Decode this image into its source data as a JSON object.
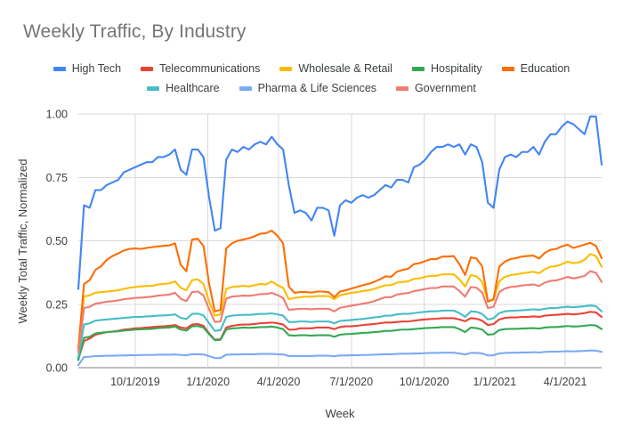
{
  "chart_data": {
    "type": "line",
    "title": "Weekly Traffic, By Industry",
    "xlabel": "Week",
    "ylabel": "Weekly Total Traffic, Normalized",
    "ylim": [
      0.0,
      1.0
    ],
    "y_ticks": [
      "0.00",
      "0.25",
      "0.50",
      "0.75",
      "1.00"
    ],
    "y_tick_values": [
      0.0,
      0.25,
      0.5,
      0.75,
      1.0
    ],
    "x_ticks": [
      "10/1/2019",
      "1/1/2020",
      "4/1/2020",
      "7/1/2020",
      "10/1/2020",
      "1/1/2021",
      "4/1/2021"
    ],
    "x_tick_positions": [
      0.1087,
      0.2478,
      0.3826,
      0.5217,
      0.6609,
      0.7957,
      0.9304
    ],
    "grid": true,
    "legend_position": "top",
    "n_points": 93,
    "series": [
      {
        "name": "High Tech",
        "color": "#4285f4",
        "values": [
          0.31,
          0.64,
          0.63,
          0.7,
          0.7,
          0.72,
          0.73,
          0.74,
          0.77,
          0.78,
          0.79,
          0.8,
          0.81,
          0.81,
          0.83,
          0.83,
          0.84,
          0.86,
          0.78,
          0.76,
          0.86,
          0.86,
          0.83,
          0.67,
          0.54,
          0.55,
          0.82,
          0.86,
          0.85,
          0.87,
          0.86,
          0.88,
          0.89,
          0.88,
          0.91,
          0.88,
          0.86,
          0.72,
          0.61,
          0.62,
          0.61,
          0.58,
          0.63,
          0.63,
          0.62,
          0.52,
          0.64,
          0.66,
          0.65,
          0.67,
          0.68,
          0.67,
          0.68,
          0.7,
          0.72,
          0.71,
          0.74,
          0.74,
          0.73,
          0.79,
          0.8,
          0.82,
          0.85,
          0.87,
          0.87,
          0.88,
          0.87,
          0.88,
          0.84,
          0.88,
          0.87,
          0.81,
          0.65,
          0.63,
          0.78,
          0.83,
          0.84,
          0.83,
          0.85,
          0.85,
          0.87,
          0.84,
          0.89,
          0.92,
          0.92,
          0.95,
          0.97,
          0.96,
          0.94,
          0.92,
          0.99,
          0.99,
          0.8
        ]
      },
      {
        "name": "Telecommunications",
        "color": "#ea4335",
        "values": [
          0.035,
          0.105,
          0.115,
          0.13,
          0.135,
          0.14,
          0.142,
          0.145,
          0.15,
          0.152,
          0.155,
          0.156,
          0.158,
          0.16,
          0.162,
          0.163,
          0.165,
          0.168,
          0.158,
          0.155,
          0.17,
          0.172,
          0.165,
          0.135,
          0.11,
          0.112,
          0.158,
          0.165,
          0.168,
          0.17,
          0.17,
          0.172,
          0.175,
          0.176,
          0.178,
          0.175,
          0.17,
          0.15,
          0.15,
          0.155,
          0.155,
          0.155,
          0.158,
          0.158,
          0.158,
          0.152,
          0.16,
          0.163,
          0.163,
          0.165,
          0.168,
          0.17,
          0.172,
          0.175,
          0.178,
          0.178,
          0.18,
          0.182,
          0.182,
          0.185,
          0.188,
          0.19,
          0.192,
          0.193,
          0.195,
          0.195,
          0.195,
          0.19,
          0.183,
          0.195,
          0.193,
          0.185,
          0.168,
          0.172,
          0.19,
          0.196,
          0.198,
          0.198,
          0.2,
          0.2,
          0.202,
          0.2,
          0.205,
          0.207,
          0.208,
          0.21,
          0.212,
          0.21,
          0.212,
          0.215,
          0.22,
          0.218,
          0.2
        ]
      },
      {
        "name": "Wholesale & Retail",
        "color": "#fbbc04",
        "values": [
          0.075,
          0.28,
          0.285,
          0.295,
          0.298,
          0.3,
          0.302,
          0.305,
          0.31,
          0.315,
          0.318,
          0.32,
          0.322,
          0.322,
          0.328,
          0.33,
          0.332,
          0.34,
          0.315,
          0.305,
          0.345,
          0.348,
          0.33,
          0.26,
          0.205,
          0.21,
          0.31,
          0.318,
          0.32,
          0.322,
          0.32,
          0.325,
          0.33,
          0.328,
          0.34,
          0.325,
          0.315,
          0.27,
          0.275,
          0.278,
          0.28,
          0.28,
          0.282,
          0.282,
          0.282,
          0.27,
          0.285,
          0.29,
          0.295,
          0.298,
          0.302,
          0.305,
          0.31,
          0.318,
          0.325,
          0.325,
          0.335,
          0.338,
          0.34,
          0.35,
          0.352,
          0.358,
          0.362,
          0.362,
          0.368,
          0.368,
          0.368,
          0.348,
          0.32,
          0.365,
          0.36,
          0.338,
          0.262,
          0.268,
          0.34,
          0.358,
          0.365,
          0.368,
          0.372,
          0.375,
          0.378,
          0.372,
          0.388,
          0.398,
          0.4,
          0.408,
          0.418,
          0.412,
          0.415,
          0.425,
          0.448,
          0.44,
          0.398
        ]
      },
      {
        "name": "Hospitality",
        "color": "#34a853",
        "values": [
          0.03,
          0.118,
          0.122,
          0.135,
          0.138,
          0.14,
          0.142,
          0.143,
          0.146,
          0.148,
          0.15,
          0.151,
          0.152,
          0.153,
          0.156,
          0.157,
          0.158,
          0.162,
          0.15,
          0.146,
          0.163,
          0.164,
          0.158,
          0.132,
          0.108,
          0.11,
          0.15,
          0.155,
          0.156,
          0.158,
          0.157,
          0.158,
          0.16,
          0.16,
          0.162,
          0.158,
          0.152,
          0.128,
          0.126,
          0.128,
          0.128,
          0.126,
          0.128,
          0.128,
          0.128,
          0.122,
          0.13,
          0.132,
          0.133,
          0.135,
          0.137,
          0.138,
          0.14,
          0.142,
          0.145,
          0.145,
          0.148,
          0.15,
          0.15,
          0.152,
          0.154,
          0.156,
          0.157,
          0.158,
          0.16,
          0.16,
          0.16,
          0.152,
          0.14,
          0.158,
          0.156,
          0.15,
          0.13,
          0.132,
          0.148,
          0.152,
          0.153,
          0.153,
          0.154,
          0.155,
          0.156,
          0.154,
          0.158,
          0.16,
          0.16,
          0.162,
          0.164,
          0.162,
          0.163,
          0.165,
          0.168,
          0.166,
          0.152
        ]
      },
      {
        "name": "Education",
        "color": "#ff6d01",
        "values": [
          0.075,
          0.33,
          0.345,
          0.385,
          0.4,
          0.425,
          0.44,
          0.45,
          0.462,
          0.468,
          0.47,
          0.468,
          0.472,
          0.475,
          0.478,
          0.48,
          0.482,
          0.49,
          0.405,
          0.38,
          0.505,
          0.508,
          0.48,
          0.33,
          0.222,
          0.228,
          0.47,
          0.49,
          0.5,
          0.505,
          0.51,
          0.518,
          0.528,
          0.53,
          0.54,
          0.52,
          0.49,
          0.32,
          0.295,
          0.298,
          0.298,
          0.296,
          0.3,
          0.3,
          0.298,
          0.278,
          0.3,
          0.305,
          0.312,
          0.318,
          0.325,
          0.33,
          0.338,
          0.348,
          0.36,
          0.358,
          0.378,
          0.385,
          0.39,
          0.408,
          0.412,
          0.42,
          0.428,
          0.428,
          0.438,
          0.438,
          0.44,
          0.408,
          0.365,
          0.435,
          0.43,
          0.4,
          0.26,
          0.27,
          0.398,
          0.418,
          0.428,
          0.432,
          0.438,
          0.44,
          0.442,
          0.43,
          0.452,
          0.465,
          0.468,
          0.478,
          0.485,
          0.472,
          0.478,
          0.485,
          0.492,
          0.48,
          0.432
        ]
      },
      {
        "name": "Healthcare",
        "color": "#46bdc6",
        "values": [
          0.04,
          0.17,
          0.175,
          0.185,
          0.188,
          0.19,
          0.192,
          0.194,
          0.196,
          0.198,
          0.2,
          0.2,
          0.202,
          0.203,
          0.205,
          0.206,
          0.207,
          0.21,
          0.196,
          0.192,
          0.212,
          0.213,
          0.206,
          0.175,
          0.145,
          0.148,
          0.2,
          0.205,
          0.207,
          0.208,
          0.208,
          0.21,
          0.212,
          0.212,
          0.214,
          0.21,
          0.205,
          0.18,
          0.18,
          0.182,
          0.182,
          0.18,
          0.182,
          0.182,
          0.182,
          0.175,
          0.184,
          0.186,
          0.188,
          0.19,
          0.192,
          0.195,
          0.198,
          0.2,
          0.205,
          0.205,
          0.21,
          0.212,
          0.212,
          0.215,
          0.218,
          0.22,
          0.222,
          0.222,
          0.225,
          0.225,
          0.225,
          0.215,
          0.2,
          0.222,
          0.22,
          0.212,
          0.19,
          0.195,
          0.215,
          0.222,
          0.224,
          0.225,
          0.226,
          0.228,
          0.23,
          0.228,
          0.232,
          0.235,
          0.235,
          0.238,
          0.24,
          0.238,
          0.24,
          0.242,
          0.245,
          0.242,
          0.222
        ]
      },
      {
        "name": "Pharma & Life Sciences",
        "color": "#7baaf7",
        "values": [
          0.01,
          0.042,
          0.043,
          0.046,
          0.046,
          0.047,
          0.047,
          0.048,
          0.048,
          0.049,
          0.049,
          0.05,
          0.05,
          0.05,
          0.051,
          0.051,
          0.051,
          0.052,
          0.05,
          0.049,
          0.053,
          0.053,
          0.052,
          0.045,
          0.038,
          0.038,
          0.051,
          0.052,
          0.052,
          0.053,
          0.053,
          0.053,
          0.054,
          0.054,
          0.054,
          0.053,
          0.052,
          0.046,
          0.046,
          0.046,
          0.046,
          0.046,
          0.047,
          0.047,
          0.047,
          0.045,
          0.048,
          0.048,
          0.049,
          0.049,
          0.05,
          0.05,
          0.051,
          0.052,
          0.053,
          0.053,
          0.054,
          0.055,
          0.055,
          0.056,
          0.056,
          0.057,
          0.058,
          0.058,
          0.059,
          0.059,
          0.059,
          0.056,
          0.052,
          0.058,
          0.058,
          0.056,
          0.048,
          0.049,
          0.056,
          0.058,
          0.059,
          0.059,
          0.06,
          0.06,
          0.061,
          0.06,
          0.062,
          0.063,
          0.063,
          0.064,
          0.065,
          0.064,
          0.065,
          0.066,
          0.068,
          0.067,
          0.062
        ]
      },
      {
        "name": "Government",
        "color": "#f07b72",
        "values": [
          0.06,
          0.235,
          0.24,
          0.252,
          0.256,
          0.26,
          0.262,
          0.265,
          0.27,
          0.272,
          0.275,
          0.276,
          0.278,
          0.28,
          0.284,
          0.286,
          0.288,
          0.295,
          0.272,
          0.262,
          0.298,
          0.3,
          0.285,
          0.23,
          0.18,
          0.182,
          0.272,
          0.28,
          0.282,
          0.284,
          0.283,
          0.286,
          0.29,
          0.29,
          0.295,
          0.286,
          0.275,
          0.228,
          0.23,
          0.232,
          0.232,
          0.23,
          0.232,
          0.232,
          0.232,
          0.222,
          0.236,
          0.24,
          0.244,
          0.248,
          0.252,
          0.256,
          0.262,
          0.27,
          0.278,
          0.278,
          0.288,
          0.292,
          0.294,
          0.302,
          0.305,
          0.31,
          0.314,
          0.314,
          0.32,
          0.32,
          0.32,
          0.302,
          0.28,
          0.318,
          0.315,
          0.296,
          0.235,
          0.24,
          0.298,
          0.312,
          0.318,
          0.32,
          0.324,
          0.326,
          0.328,
          0.322,
          0.335,
          0.342,
          0.344,
          0.35,
          0.358,
          0.352,
          0.356,
          0.362,
          0.38,
          0.374,
          0.338
        ]
      }
    ]
  },
  "legend": {
    "row1": [
      {
        "label": "High Tech",
        "color": "#4285f4"
      },
      {
        "label": "Telecommunications",
        "color": "#ea4335"
      },
      {
        "label": "Wholesale & Retail",
        "color": "#fbbc04"
      },
      {
        "label": "Hospitality",
        "color": "#34a853"
      },
      {
        "label": "Education",
        "color": "#ff6d01"
      }
    ],
    "row2": [
      {
        "label": "Healthcare",
        "color": "#46bdc6"
      },
      {
        "label": "Pharma & Life Sciences",
        "color": "#7baaf7"
      },
      {
        "label": "Government",
        "color": "#f07b72"
      }
    ]
  }
}
